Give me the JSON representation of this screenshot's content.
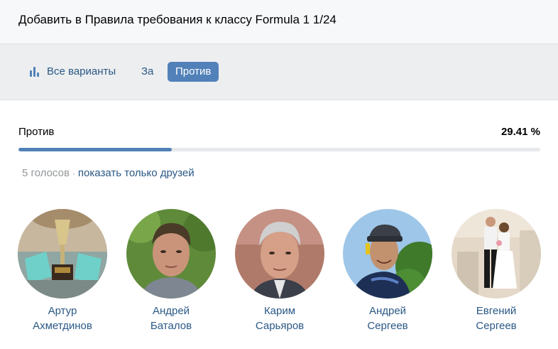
{
  "poll": {
    "title": "Добавить в Правила требования к классу Formula 1 1/24"
  },
  "filters": {
    "all_label": "Все варианты",
    "for_label": "За",
    "against_label": "Против",
    "active": "against",
    "all_icon": "bar-chart-icon"
  },
  "option": {
    "label": "Против",
    "percent_text": "29.41 %",
    "percent_value": 29.41
  },
  "votes": {
    "count_text": "5 голосов",
    "separator": "·",
    "friends_link": "показать только друзей"
  },
  "voters": [
    {
      "first": "Артур",
      "last": "Ахметдинов"
    },
    {
      "first": "Андрей",
      "last": "Баталов"
    },
    {
      "first": "Карим",
      "last": "Сарьяров"
    },
    {
      "first": "Андрей",
      "last": "Сергеев"
    },
    {
      "first": "Евгений",
      "last": "Сергеев"
    }
  ],
  "colors": {
    "accent": "#5181b8",
    "link": "#2a5885",
    "muted": "#939699",
    "track": "#e7e8ec"
  }
}
